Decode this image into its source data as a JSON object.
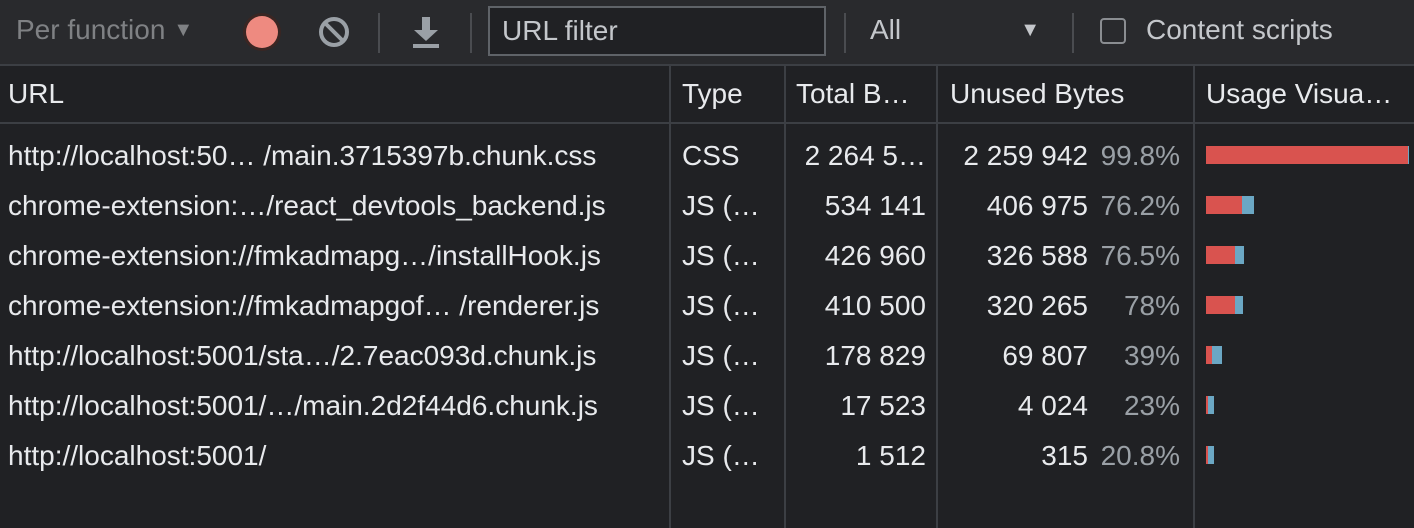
{
  "toolbar": {
    "mode_label": "Per function",
    "filter_placeholder": "URL filter",
    "type_value": "All",
    "content_scripts_label": "Content scripts",
    "record_color": "#ee8a80"
  },
  "columns": {
    "url": "URL",
    "type": "Type",
    "total": "Total B…",
    "unused": "Unused Bytes",
    "usage": "Usage Visua…"
  },
  "colors": {
    "unused": "#d9534f",
    "used": "#6ba7c4"
  },
  "rows": [
    {
      "url": "http://localhost:50…  /main.3715397b.chunk.css",
      "type": "CSS",
      "total": "2 264 5…",
      "unused": "2 259 942",
      "pct": "99.8%",
      "total_bytes": 2264584,
      "unused_fraction": 0.998
    },
    {
      "url": "chrome-extension:…/react_devtools_backend.js",
      "type": "JS (…",
      "total": "534 141",
      "unused": "406 975",
      "pct": "76.2%",
      "total_bytes": 534141,
      "unused_fraction": 0.762
    },
    {
      "url": "chrome-extension://fmkadmapg…/installHook.js",
      "type": "JS (…",
      "total": "426 960",
      "unused": "326 588",
      "pct": "76.5%",
      "total_bytes": 426960,
      "unused_fraction": 0.765
    },
    {
      "url": "chrome-extension://fmkadmapgof…  /renderer.js",
      "type": "JS (…",
      "total": "410 500",
      "unused": "320 265",
      "pct": "78%",
      "total_bytes": 410500,
      "unused_fraction": 0.78
    },
    {
      "url": "http://localhost:5001/sta…/2.7eac093d.chunk.js",
      "type": "JS (…",
      "total": "178 829",
      "unused": "69 807",
      "pct": "39%",
      "total_bytes": 178829,
      "unused_fraction": 0.39
    },
    {
      "url": "http://localhost:5001/…/main.2d2f44d6.chunk.js",
      "type": "JS (…",
      "total": "17 523",
      "unused": "4 024",
      "pct": "23%",
      "total_bytes": 17523,
      "unused_fraction": 0.23
    },
    {
      "url": "http://localhost:5001/",
      "type": "JS (…",
      "total": "1 512",
      "unused": "315",
      "pct": "20.8%",
      "total_bytes": 1512,
      "unused_fraction": 0.208
    }
  ]
}
